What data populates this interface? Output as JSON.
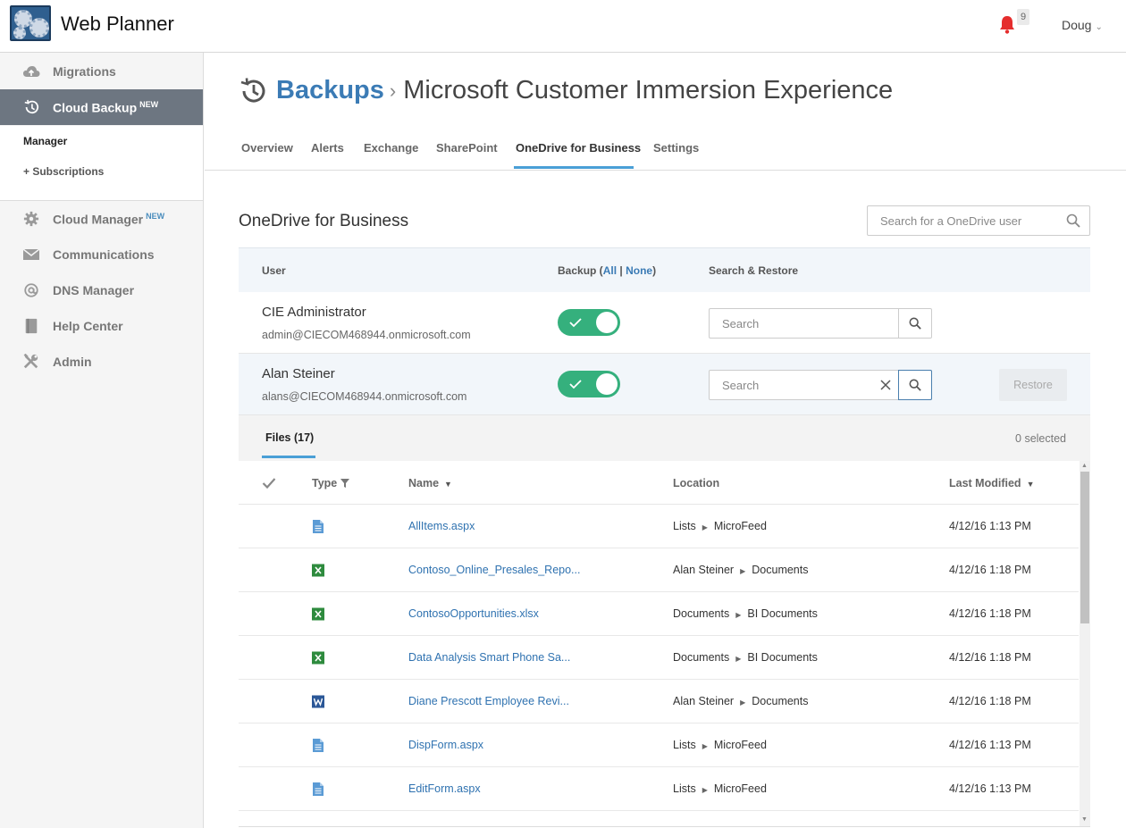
{
  "app": {
    "title": "Web Planner",
    "notifications": "9",
    "user": "Doug"
  },
  "sidebar": {
    "items": [
      {
        "label": "Migrations",
        "badge": ""
      },
      {
        "label": "Cloud Backup",
        "badge": "NEW"
      },
      {
        "label": "Cloud Manager",
        "badge": "NEW"
      },
      {
        "label": "Communications",
        "badge": ""
      },
      {
        "label": "DNS Manager",
        "badge": ""
      },
      {
        "label": "Help Center",
        "badge": ""
      },
      {
        "label": "Admin",
        "badge": ""
      }
    ],
    "sub": {
      "manager": "Manager",
      "subscriptions": "+ Subscriptions"
    }
  },
  "breadcrumb": {
    "root": "Backups",
    "sep": "›",
    "current": "Microsoft Customer Immersion Experience"
  },
  "tabs": [
    "Overview",
    "Alerts",
    "Exchange",
    "SharePoint",
    "OneDrive for Business",
    "Settings"
  ],
  "section": {
    "title": "OneDrive for Business",
    "search_placeholder": "Search for a OneDrive user"
  },
  "users_table": {
    "headers": {
      "user": "User",
      "backup": "Backup (",
      "all": "All",
      "divider": "|",
      "none": "None",
      "close": ")",
      "search_restore": "Search & Restore"
    },
    "rows": [
      {
        "name": "CIE Administrator",
        "email": "admin@CIECOM468944.onmicrosoft.com",
        "search_placeholder": "Search",
        "search_value": ""
      },
      {
        "name": "Alan Steiner",
        "email": "alans@CIECOM468944.onmicrosoft.com",
        "search_placeholder": "Search",
        "search_value": "",
        "restore_label": "Restore"
      }
    ]
  },
  "files": {
    "tab": "Files (17)",
    "selected": "0 selected",
    "headers": {
      "type": "Type",
      "name": "Name",
      "location": "Location",
      "modified": "Last Modified"
    },
    "rows": [
      {
        "type": "page",
        "name": "AllItems.aspx",
        "loc1": "Lists",
        "loc2": "MicroFeed",
        "modified": "4/12/16 1:13 PM"
      },
      {
        "type": "excel",
        "name": "Contoso_Online_Presales_Repo...",
        "loc1": "Alan Steiner",
        "loc2": "Documents",
        "modified": "4/12/16 1:18 PM"
      },
      {
        "type": "excel",
        "name": "ContosoOpportunities.xlsx",
        "loc1": "Documents",
        "loc2": "BI Documents",
        "modified": "4/12/16 1:18 PM"
      },
      {
        "type": "excel",
        "name": "Data Analysis Smart Phone Sa...",
        "loc1": "Documents",
        "loc2": "BI Documents",
        "modified": "4/12/16 1:18 PM"
      },
      {
        "type": "word",
        "name": "Diane Prescott Employee Revi...",
        "loc1": "Alan Steiner",
        "loc2": "Documents",
        "modified": "4/12/16 1:18 PM"
      },
      {
        "type": "page",
        "name": "DispForm.aspx",
        "loc1": "Lists",
        "loc2": "MicroFeed",
        "modified": "4/12/16 1:13 PM"
      },
      {
        "type": "page",
        "name": "EditForm.aspx",
        "loc1": "Lists",
        "loc2": "MicroFeed",
        "modified": "4/12/16 1:13 PM"
      }
    ]
  },
  "colors": {
    "accent": "#3b7bb5",
    "toggle_on": "#35b07d",
    "sidebar_active": "#6d7681",
    "tab_underline": "#4a9fd6",
    "bell": "#e52d2d",
    "excel": "#2e8b3e",
    "word": "#2b5797"
  },
  "icons": [
    "logo-icon",
    "bell-icon",
    "cloud-icon",
    "history-icon",
    "gear-icon",
    "envelope-icon",
    "at-icon",
    "book-icon",
    "tools-icon",
    "search-icon",
    "check-icon",
    "clear-icon",
    "filter-icon",
    "file-icon",
    "excel-icon",
    "word-icon"
  ]
}
